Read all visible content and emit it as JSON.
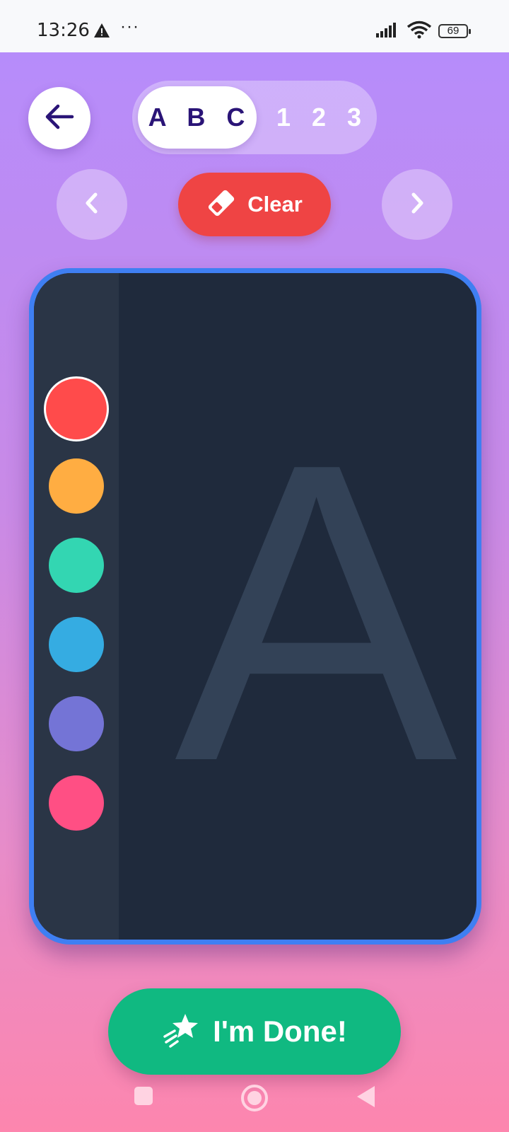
{
  "status_bar": {
    "time": "13:26",
    "dots": "···",
    "battery": "69",
    "icons": [
      "warning-icon",
      "signal-icon",
      "wifi-icon",
      "battery-icon"
    ]
  },
  "header": {
    "back_icon": "arrow-left-icon",
    "mode_toggle": {
      "selected": "A B C",
      "other": "1 2 3"
    }
  },
  "toolbar": {
    "prev_icon": "chevron-left-icon",
    "next_icon": "chevron-right-icon",
    "clear_label": "Clear",
    "clear_icon": "eraser-icon"
  },
  "palette": {
    "colors": [
      "#ff4b4b",
      "#ffad42",
      "#33d6b2",
      "#35ace2",
      "#7474d6",
      "#ff4f84"
    ],
    "selected_index": 0
  },
  "canvas": {
    "guide_letter": "A",
    "border_color": "#3f7ff2",
    "background_color": "#1f2a3c"
  },
  "done_button": {
    "label": "I'm Done!",
    "icon": "shooting-star-icon",
    "color": "#10b981"
  },
  "nav_bar": {
    "icons": [
      "recents-square-icon",
      "home-circle-icon",
      "back-triangle-icon"
    ]
  }
}
